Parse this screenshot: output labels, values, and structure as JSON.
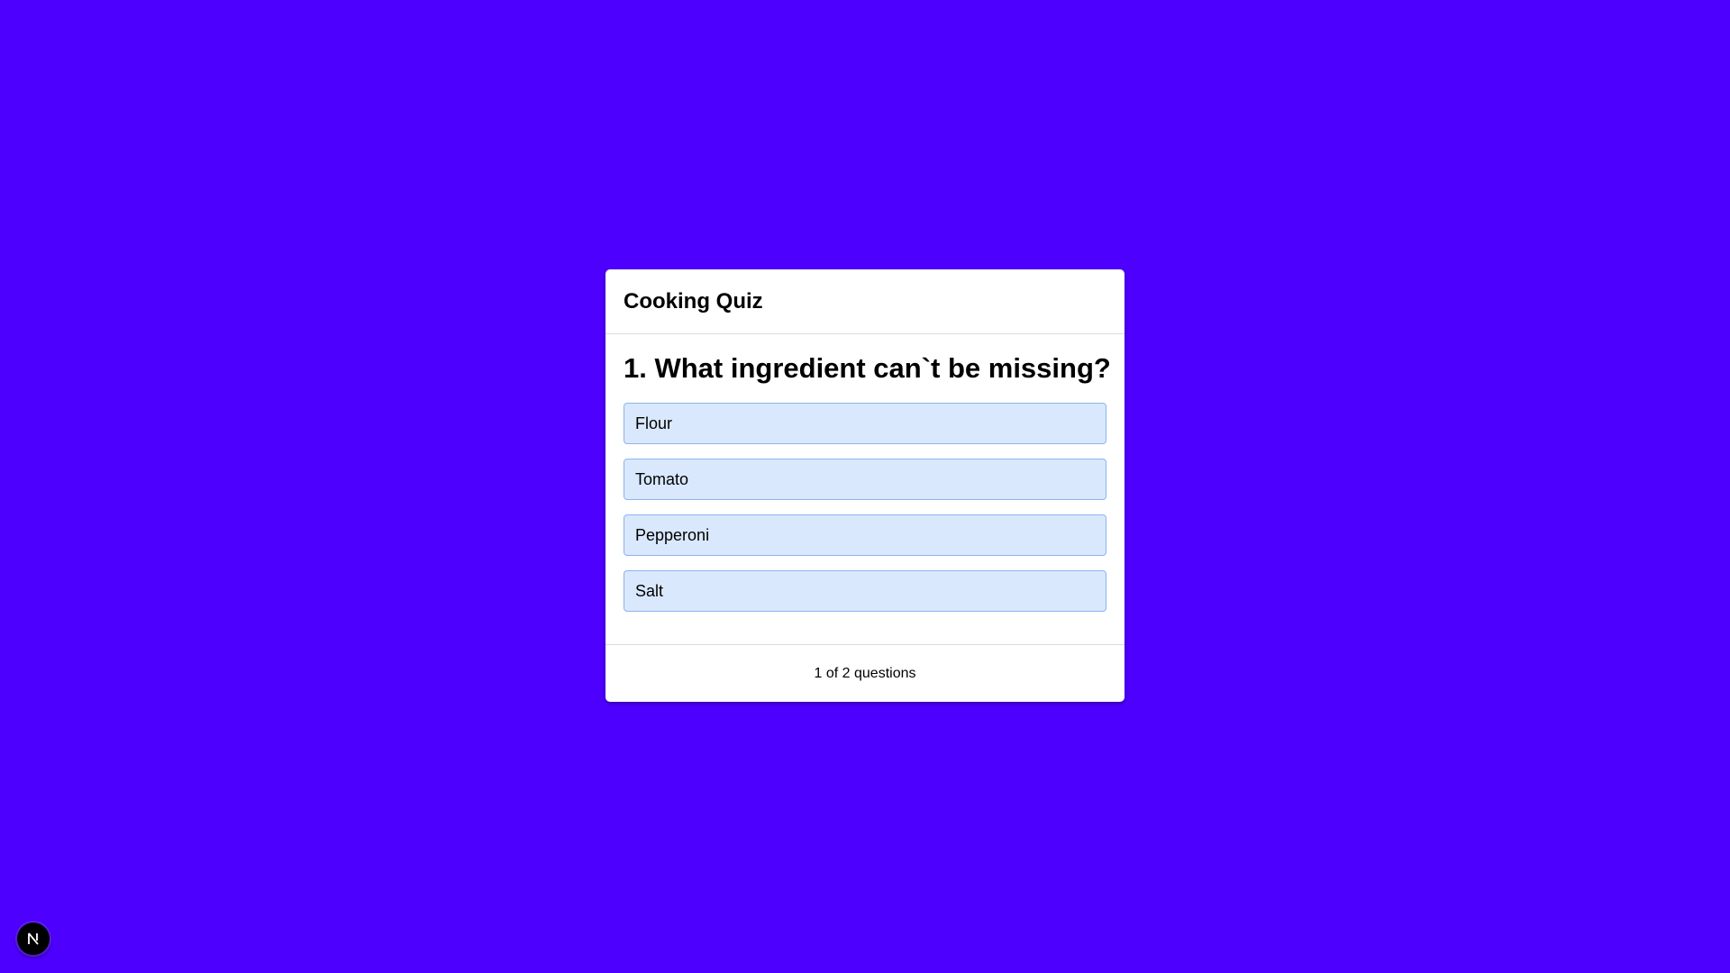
{
  "quiz": {
    "title": "Cooking Quiz",
    "question": "1. What ingredient can`t be missing?",
    "options": [
      {
        "label": "Flour"
      },
      {
        "label": "Tomato"
      },
      {
        "label": "Pepperoni"
      },
      {
        "label": "Salt"
      }
    ],
    "progress_text": "1 of 2 questions"
  },
  "dev_indicator": {
    "icon": "nextjs-logo-icon"
  },
  "colors": {
    "background": "#4e00ff",
    "option_fill": "#d9e8fd",
    "option_border": "#8eb4ee",
    "card": "#ffffff"
  }
}
